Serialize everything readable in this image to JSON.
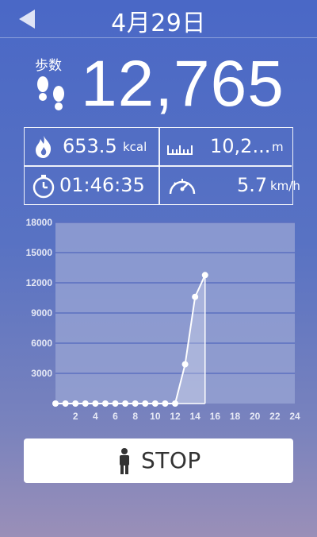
{
  "header": {
    "title": "4月29日",
    "back_icon": "back-arrow-icon"
  },
  "steps": {
    "label": "歩数",
    "value": "12,765",
    "icon": "footprints-icon"
  },
  "stats": {
    "calories": {
      "value": "653.5",
      "unit": "kcal",
      "icon": "flame-icon"
    },
    "distance": {
      "value": "10,2...",
      "unit": "m",
      "icon": "ruler-icon"
    },
    "time": {
      "value": "01:46:35",
      "icon": "stopwatch-icon"
    },
    "speed": {
      "value": "5.7",
      "unit": "km/h",
      "icon": "speedometer-icon"
    }
  },
  "chart_data": {
    "type": "area",
    "ylim": [
      0,
      18000
    ],
    "xlim": [
      0,
      24
    ],
    "yticks": [
      "3000",
      "6000",
      "9000",
      "12000",
      "15000",
      "18000"
    ],
    "xticks": [
      "2",
      "4",
      "6",
      "8",
      "10",
      "12",
      "14",
      "16",
      "18",
      "20",
      "22",
      "24"
    ],
    "x": [
      0,
      1,
      2,
      3,
      4,
      5,
      6,
      7,
      8,
      9,
      10,
      11,
      12,
      13,
      14,
      15
    ],
    "values": [
      0,
      0,
      0,
      0,
      0,
      0,
      0,
      0,
      0,
      0,
      0,
      0,
      0,
      3900,
      10600,
      12765
    ],
    "grid": true
  },
  "stop_button": {
    "label": "STOP",
    "icon": "person-icon"
  },
  "colors": {
    "accent": "#4a68c6",
    "chart_bg": "#9aa6d4",
    "grid": "#5b6fc0"
  }
}
